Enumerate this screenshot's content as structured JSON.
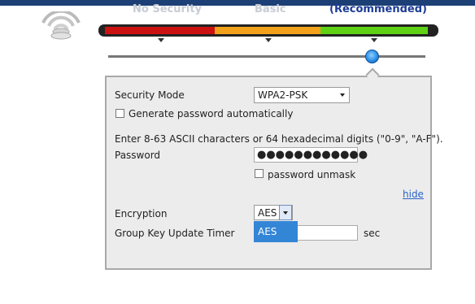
{
  "header": {
    "accent": "#1c3f75"
  },
  "wifi_icon": "wifi-router-icon",
  "levels": [
    {
      "label": "No Security",
      "color": "#cc1111"
    },
    {
      "label": "Basic",
      "color": "#f2a21a"
    },
    {
      "label": "(Recommended)",
      "color": "#5fd114"
    }
  ],
  "slider": {
    "selected_level": "(Recommended)"
  },
  "form": {
    "security_mode": {
      "label": "Security Mode",
      "value": "WPA2-PSK"
    },
    "generate_auto": {
      "label": "Generate password automatically",
      "checked": false
    },
    "hint": "Enter 8-63 ASCII characters or 64 hexadecimal digits (\"0-9\", \"A-F\").",
    "password": {
      "label": "Password",
      "value": "●●●●●●●●●●●●"
    },
    "unmask": {
      "label": "password unmask",
      "checked": false
    },
    "hide_link": "hide",
    "encryption": {
      "label": "Encryption",
      "value": "AES",
      "options": [
        "AES"
      ]
    },
    "group_key": {
      "label": "Group Key Update Timer",
      "value": "",
      "unit": "sec"
    }
  }
}
